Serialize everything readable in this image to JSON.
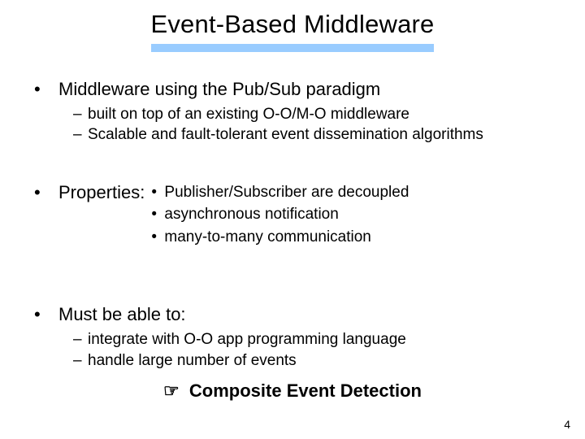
{
  "title": "Event-Based Middleware",
  "bullets": {
    "b1": {
      "text": "Middleware using the Pub/Sub paradigm",
      "sub": [
        "built on top of an existing O-O/M-O middleware",
        "Scalable and fault-tolerant event dissemination algorithms"
      ]
    },
    "b2": {
      "label": "Properties:",
      "sub": [
        "Publisher/Subscriber are decoupled",
        "asynchronous notification",
        "many-to-many communication"
      ]
    },
    "b3": {
      "text": "Must be able to:",
      "sub": [
        "integrate with O-O app programming language",
        "handle large number of events"
      ]
    }
  },
  "callout": {
    "icon": "☞",
    "text": "Composite Event Detection"
  },
  "page_number": "4"
}
